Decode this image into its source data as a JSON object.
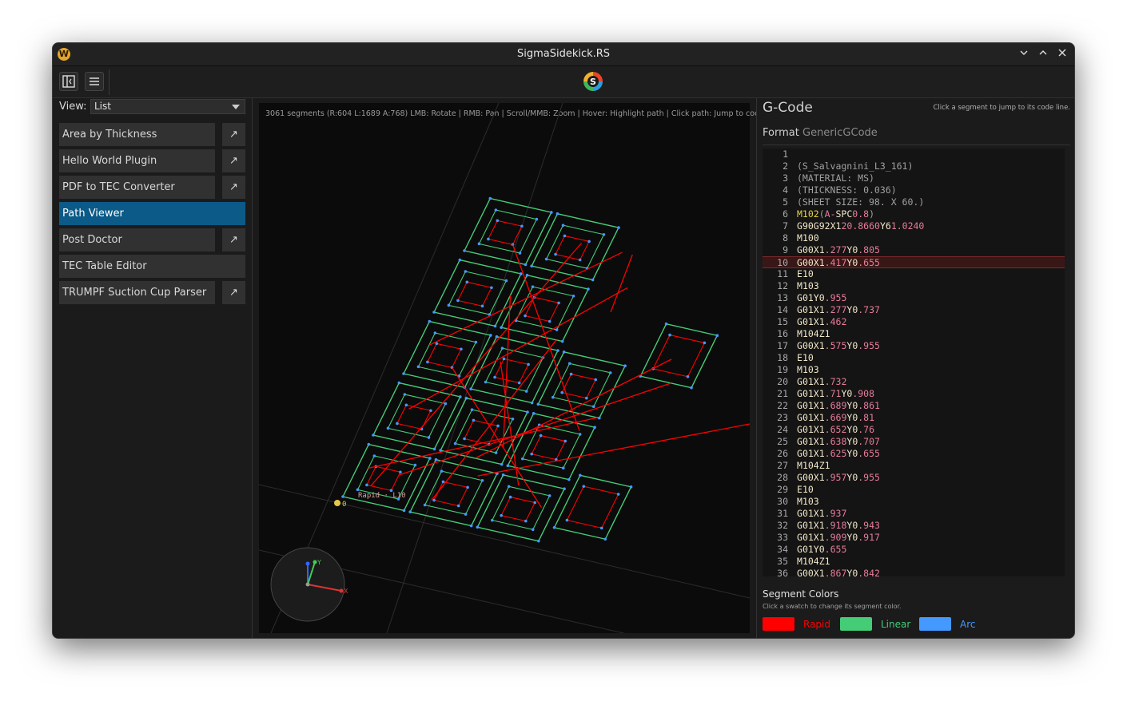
{
  "window": {
    "title": "SigmaSidekick.RS",
    "app_icon": "W"
  },
  "left_panel": {
    "view_label": "View:",
    "view_value": "List",
    "plugins": [
      {
        "label": "Area by Thickness",
        "launch": true
      },
      {
        "label": "Hello World Plugin",
        "launch": true
      },
      {
        "label": "PDF to TEC Converter",
        "launch": true
      },
      {
        "label": "Path Viewer",
        "launch": false,
        "active": true
      },
      {
        "label": "Post Doctor",
        "launch": true
      },
      {
        "label": "TEC Table Editor",
        "launch": false
      },
      {
        "label": "TRUMPF Suction Cup Parser",
        "launch": true
      }
    ]
  },
  "viewport": {
    "status": "3061 segments  (R:604 L:1689 A:768)  LMB: Rotate  |  RMB: Pan  |  Scroll/MMB: Zoom  |  Hover: Highlight path  |  Click path: Jump to code",
    "origin_label": "0",
    "hover_label": "Rapid · L10",
    "axis_x": "X",
    "axis_y": "Y"
  },
  "gcode": {
    "title": "G-Code",
    "hint": "Click a segment to jump to its code line.",
    "format_label": "Format",
    "format_value": "GenericGCode",
    "highlighted_line": 10,
    "lines": [
      {
        "n": "1",
        "t": ""
      },
      {
        "n": "2",
        "t": "(S_Salvagnini_L3_161)"
      },
      {
        "n": "3",
        "t": "(MATERIAL: MS)"
      },
      {
        "n": "4",
        "t": "(THICKNESS: 0.036)"
      },
      {
        "n": "5",
        "t": "(SHEET SIZE: 98. X 60.)"
      },
      {
        "n": "6",
        "t": "M102(A-SPC0.8)"
      },
      {
        "n": "7",
        "t": "G90G92X120.8660Y61.0240"
      },
      {
        "n": "8",
        "t": "M100"
      },
      {
        "n": "9",
        "t": "G00X1.277Y0.805"
      },
      {
        "n": "10",
        "t": "G00X1.417Y0.655"
      },
      {
        "n": "11",
        "t": "E10"
      },
      {
        "n": "12",
        "t": "M103"
      },
      {
        "n": "13",
        "t": "G01Y0.955"
      },
      {
        "n": "14",
        "t": "G01X1.277Y0.737"
      },
      {
        "n": "15",
        "t": "G01X1.462"
      },
      {
        "n": "16",
        "t": "M104Z1"
      },
      {
        "n": "17",
        "t": "G00X1.575Y0.955"
      },
      {
        "n": "18",
        "t": "E10"
      },
      {
        "n": "19",
        "t": "M103"
      },
      {
        "n": "20",
        "t": "G01X1.732"
      },
      {
        "n": "21",
        "t": "G01X1.71Y0.908"
      },
      {
        "n": "22",
        "t": "G01X1.689Y0.861"
      },
      {
        "n": "23",
        "t": "G01X1.669Y0.81"
      },
      {
        "n": "24",
        "t": "G01X1.652Y0.76"
      },
      {
        "n": "25",
        "t": "G01X1.638Y0.707"
      },
      {
        "n": "26",
        "t": "G01X1.625Y0.655"
      },
      {
        "n": "27",
        "t": "M104Z1"
      },
      {
        "n": "28",
        "t": "G00X1.957Y0.955"
      },
      {
        "n": "29",
        "t": "E10"
      },
      {
        "n": "30",
        "t": "M103"
      },
      {
        "n": "31",
        "t": "G01X1.937"
      },
      {
        "n": "32",
        "t": "G01X1.918Y0.943"
      },
      {
        "n": "33",
        "t": "G01X1.909Y0.917"
      },
      {
        "n": "34",
        "t": "G01Y0.655"
      },
      {
        "n": "35",
        "t": "M104Z1"
      },
      {
        "n": "36",
        "t": "G00X1.867Y0.842"
      }
    ]
  },
  "segment_colors": {
    "title": "Segment Colors",
    "hint": "Click a swatch to change its segment color.",
    "items": [
      {
        "label": "Rapid",
        "color": "#ff0000"
      },
      {
        "label": "Linear",
        "color": "#44cc77"
      },
      {
        "label": "Arc",
        "color": "#4499ff"
      }
    ]
  },
  "colors": {
    "accent": "#0b5a87",
    "code_number": "#e87c9a",
    "code_cmd": "#f0e6c8",
    "code_comment": "#a0a0a0",
    "code_special": "#e6d24a"
  }
}
